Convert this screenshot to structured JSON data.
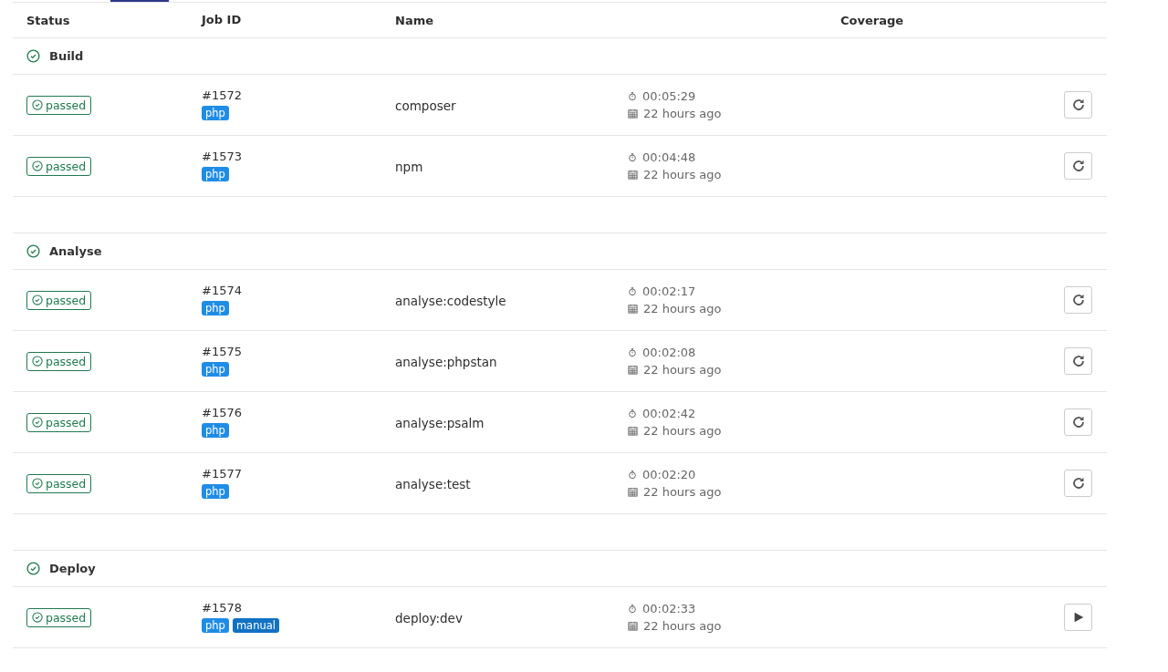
{
  "table": {
    "columns": [
      "Status",
      "Job ID",
      "Name",
      "Coverage"
    ],
    "stages": [
      {
        "name": "Build",
        "jobs": [
          {
            "status": "passed",
            "id": "#1572",
            "tags": [
              "php"
            ],
            "name": "composer",
            "duration": "00:05:29",
            "finished": "22 hours ago",
            "kind": "retry"
          },
          {
            "status": "passed",
            "id": "#1573",
            "tags": [
              "php"
            ],
            "name": "npm",
            "duration": "00:04:48",
            "finished": "22 hours ago",
            "kind": "retry"
          }
        ]
      },
      {
        "name": "Analyse",
        "jobs": [
          {
            "status": "passed",
            "id": "#1574",
            "tags": [
              "php"
            ],
            "name": "analyse:codestyle",
            "duration": "00:02:17",
            "finished": "22 hours ago",
            "kind": "retry"
          },
          {
            "status": "passed",
            "id": "#1575",
            "tags": [
              "php"
            ],
            "name": "analyse:phpstan",
            "duration": "00:02:08",
            "finished": "22 hours ago",
            "kind": "retry"
          },
          {
            "status": "passed",
            "id": "#1576",
            "tags": [
              "php"
            ],
            "name": "analyse:psalm",
            "duration": "00:02:42",
            "finished": "22 hours ago",
            "kind": "retry"
          },
          {
            "status": "passed",
            "id": "#1577",
            "tags": [
              "php"
            ],
            "name": "analyse:test",
            "duration": "00:02:20",
            "finished": "22 hours ago",
            "kind": "retry"
          }
        ]
      },
      {
        "name": "Deploy",
        "jobs": [
          {
            "status": "passed",
            "id": "#1578",
            "tags": [
              "php",
              "manual"
            ],
            "name": "deploy:dev",
            "duration": "00:02:33",
            "finished": "22 hours ago",
            "kind": "play"
          }
        ]
      }
    ]
  }
}
